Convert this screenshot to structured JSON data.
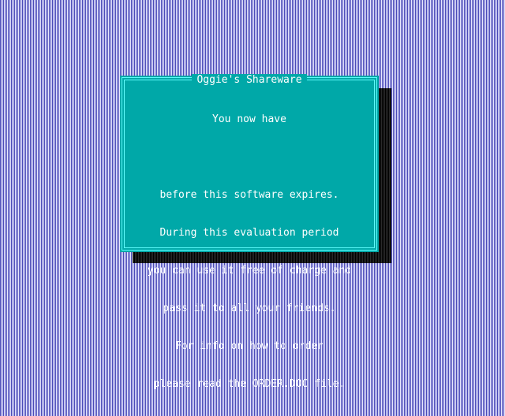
{
  "dialog": {
    "title": "Oggie's Shareware",
    "lines": [
      "You now have",
      "",
      "before this software expires.",
      "During this evaluation period",
      "you can use it free of charge and",
      "pass it to all your friends.",
      "For info on how to order",
      "please read the ORDER.DOC file."
    ]
  },
  "colors": {
    "dialog_background": "#00a8a8",
    "dialog_border": "#5ffcfc",
    "text": "#ffffff",
    "desktop_pattern_dark": "#4a4ab8",
    "desktop_pattern_light": "#e8e8ff",
    "shadow": "#101010"
  }
}
